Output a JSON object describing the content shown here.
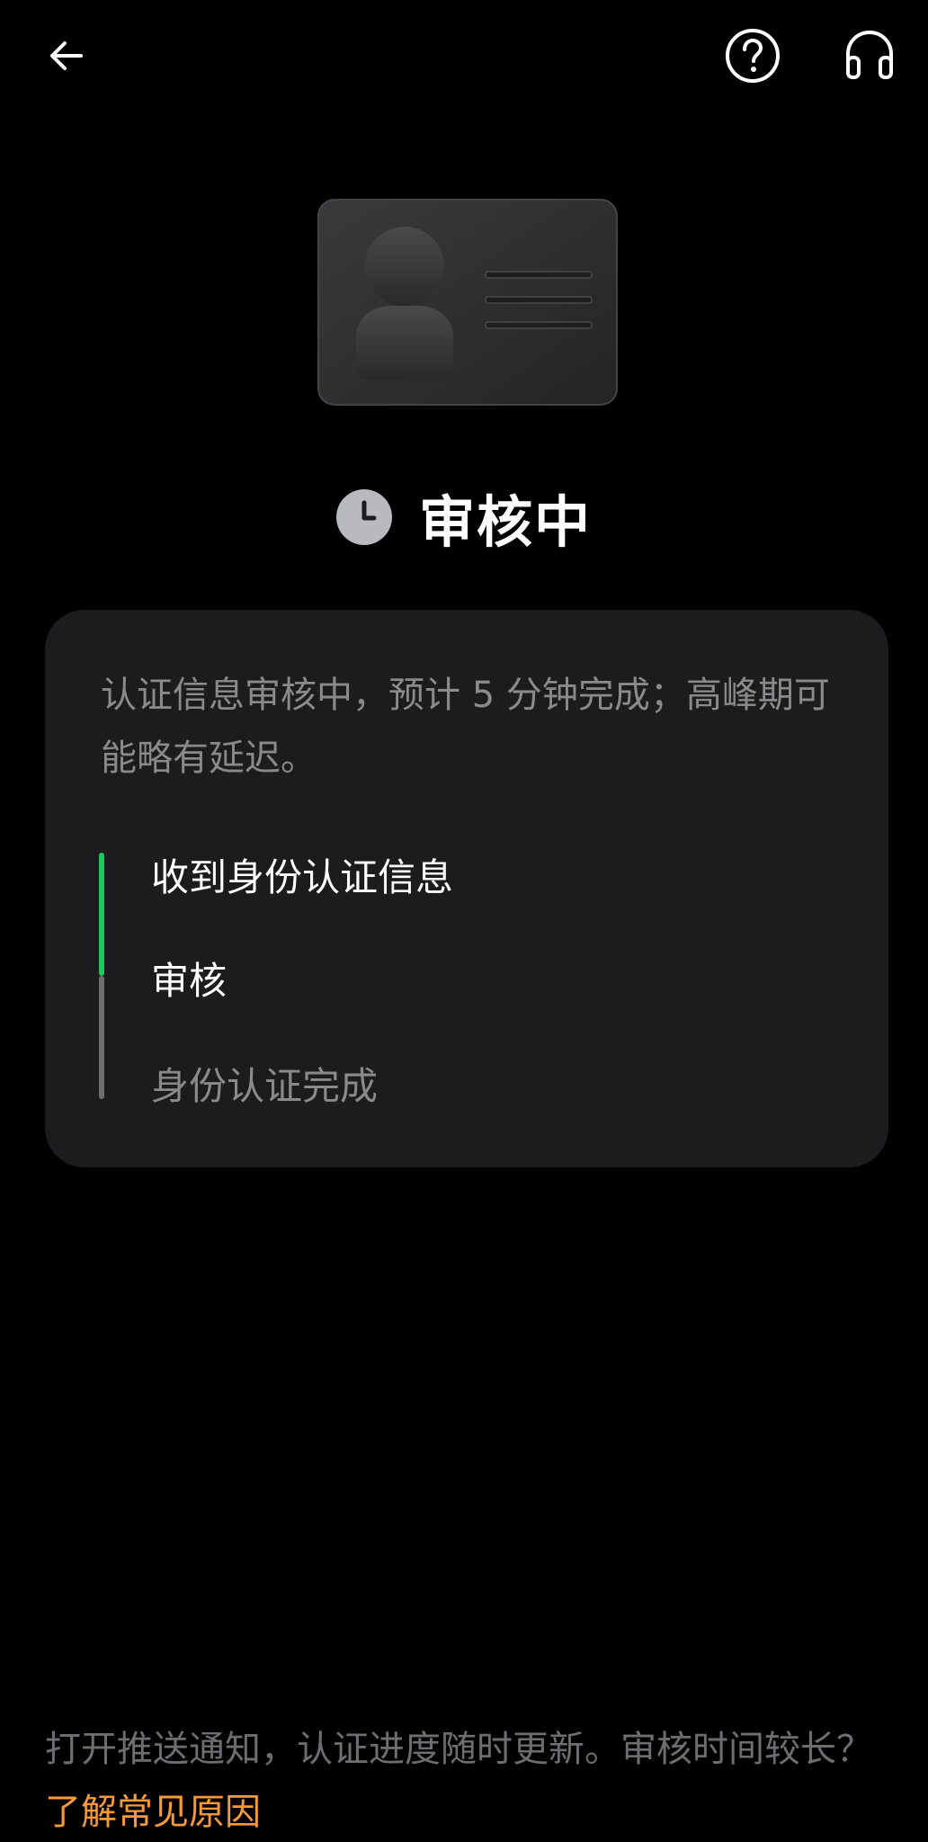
{
  "header": {
    "back_icon": "arrow-left-icon",
    "help_icon": "question-circle-icon",
    "support_icon": "headphones-icon"
  },
  "hero": {
    "icon": "id-card-illustration"
  },
  "status": {
    "icon": "clock-icon",
    "title": "审核中"
  },
  "card": {
    "description": "认证信息审核中，预计 5 分钟完成；高峰期可能略有延迟。",
    "steps": [
      {
        "label": "收到身份认证信息",
        "state": "done"
      },
      {
        "label": "审核",
        "state": "current"
      },
      {
        "label": "身份认证完成",
        "state": "pending"
      }
    ]
  },
  "footer": {
    "text": "打开推送通知，认证进度随时更新。审核时间较长？",
    "link_label": "了解常见原因"
  },
  "colors": {
    "background": "#000000",
    "card": "#1c1c1e",
    "progress_done": "#22c55e",
    "progress_pending": "#6e6e72",
    "link": "#f59a3b"
  }
}
